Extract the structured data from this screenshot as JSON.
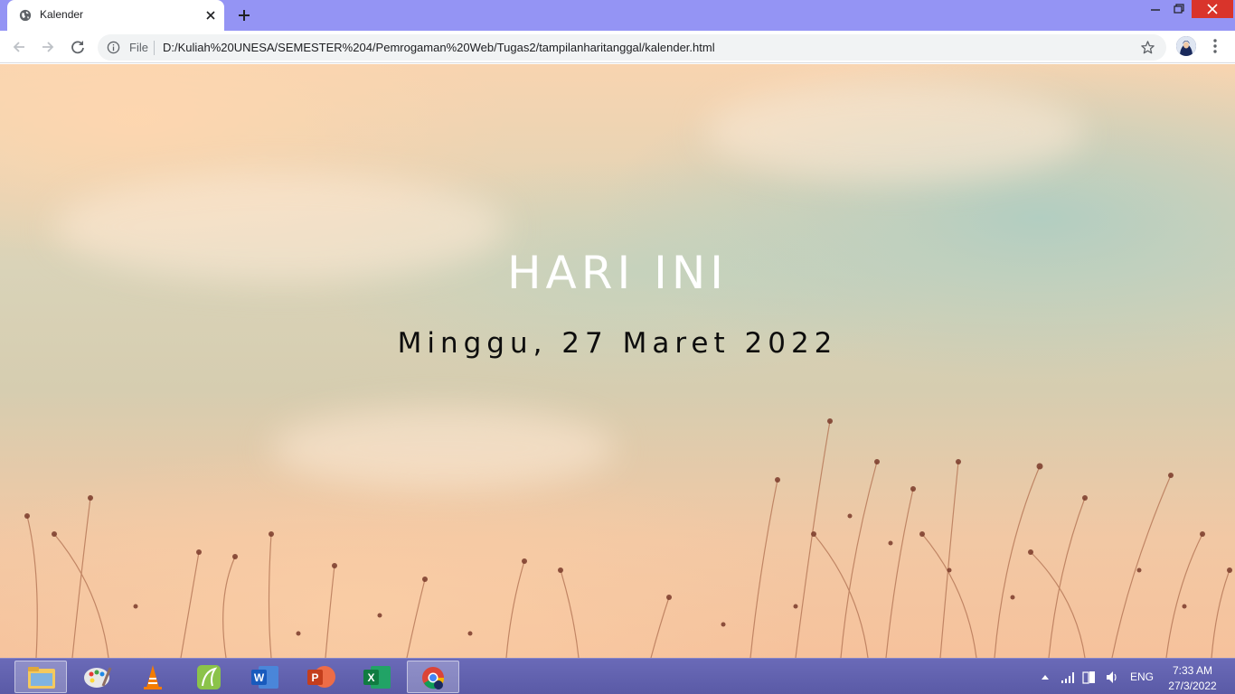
{
  "browser": {
    "tab": {
      "title": "Kalender"
    },
    "omnibox": {
      "scheme_label": "File",
      "url": "D:/Kuliah%20UNESA/SEMESTER%204/Pemrogaman%20Web/Tugas2/tampilanharitanggal/kalender.html"
    }
  },
  "page": {
    "heading": "HARI INI",
    "date": "Minggu, 27 Maret 2022"
  },
  "taskbar": {
    "apps": [
      "file-explorer-icon",
      "paint-icon",
      "vlc-icon",
      "coreldraw-icon",
      "word-icon",
      "powerpoint-icon",
      "excel-icon",
      "chrome-icon"
    ],
    "tray": {
      "language": "ENG",
      "time": "7:33 AM",
      "date": "27/3/2022"
    }
  },
  "colors": {
    "titlebar": "#9494f4",
    "close_button": "#d9342b",
    "heading_text": "#ffffff",
    "date_text": "#0d0d0d",
    "taskbar": "#5a5aa6"
  }
}
